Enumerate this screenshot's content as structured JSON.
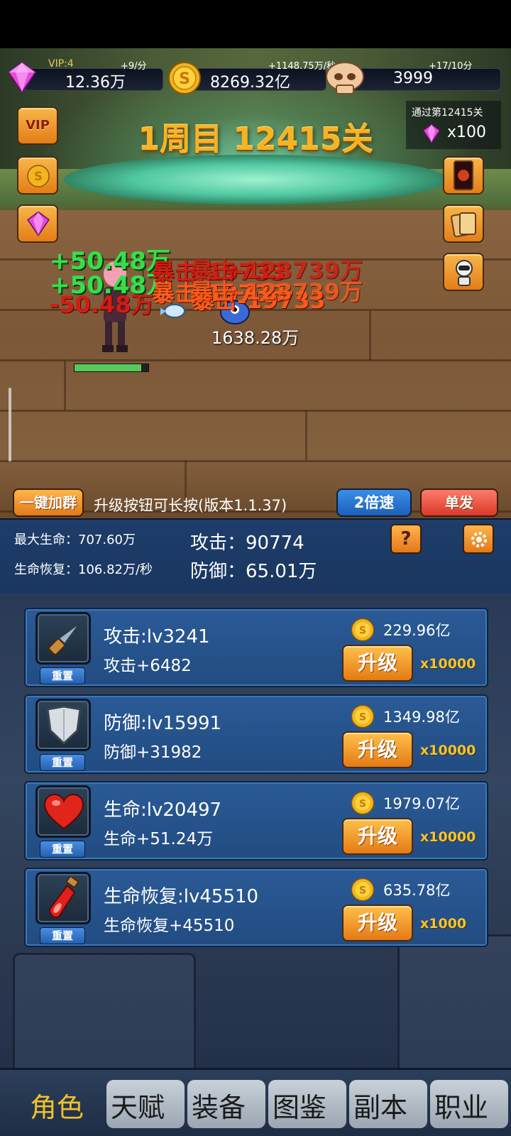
{
  "resources": {
    "gems": {
      "vip": "VIP:4",
      "rate": "+9/分",
      "value": "12.36万"
    },
    "coins": {
      "rate": "+1148.75万/秒",
      "value": "8269.32亿"
    },
    "skulls": {
      "rate": "+17/10分",
      "value": "3999"
    }
  },
  "stage": {
    "title": "1周目 12415关",
    "reward_label": "通过第12415关",
    "reward_count": "x100"
  },
  "side_left": {
    "vip_label": "VIP"
  },
  "battle": {
    "floating": {
      "g1": "+50.48万",
      "g2": "+50.48万",
      "r1": "-50.48万",
      "c1": "暴击-19733",
      "c2": "暴击-19733",
      "c3": "暴击-19733",
      "t1": "暴击-123739万",
      "t2": "暴击-123739万"
    },
    "damage_total": "1638.28万",
    "hp_fraction": 0.9
  },
  "controls": {
    "join_group": "一键加群",
    "tip": "升级按钮可长按(版本1.1.37)",
    "speed": "2倍速",
    "mode": "单发"
  },
  "stats": {
    "max_hp": "最大生命：707.60万",
    "regen": "生命恢复：106.82万/秒",
    "attack": "攻击：90774",
    "defense": "防御：65.01万",
    "help": "?"
  },
  "upgrades": [
    {
      "name": "攻击:lv3241",
      "bonus": "攻击+6482",
      "cost": "229.96亿",
      "button": "升级",
      "mult": "x10000",
      "reset": "重置",
      "icon": "dagger-icon"
    },
    {
      "name": "防御:lv15991",
      "bonus": "防御+31982",
      "cost": "1349.98亿",
      "button": "升级",
      "mult": "x10000",
      "reset": "重置",
      "icon": "shield-icon"
    },
    {
      "name": "生命:lv20497",
      "bonus": "生命+51.24万",
      "cost": "1979.07亿",
      "button": "升级",
      "mult": "x10000",
      "reset": "重置",
      "icon": "heart-icon"
    },
    {
      "name": "生命恢复:lv45510",
      "bonus": "生命恢复+45510",
      "cost": "635.78亿",
      "button": "升级",
      "mult": "x1000",
      "reset": "重置",
      "icon": "potion-icon"
    }
  ],
  "nav": [
    "角色",
    "天赋",
    "装备",
    "图鉴",
    "副本",
    "职业"
  ],
  "colors": {
    "accent": "#f1c02c",
    "button": "#e2781a",
    "panel": "#224c82"
  }
}
